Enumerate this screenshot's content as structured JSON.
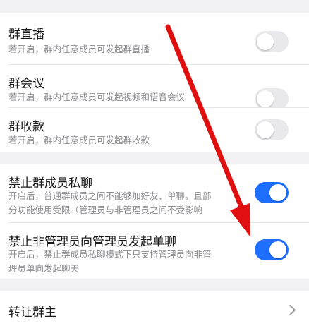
{
  "settings": {
    "group_live": {
      "title": "群直播",
      "desc": "若开启，群内任意成员可发起群直播",
      "enabled": false
    },
    "group_meeting": {
      "title": "群会议",
      "desc": "若开启，群内任意成员可发起视频和语音会议",
      "enabled": false
    },
    "group_payment": {
      "title": "群收款",
      "desc": "若开启，群内任意成员可发起群收款",
      "enabled": false
    },
    "ban_private_chat": {
      "title": "禁止群成员私聊",
      "desc_line1": "开启后，普通群成员之间不能够加好友、单聊，且部",
      "desc_line2": "分功能使用受限（管理员与非管理员之间不受影响",
      "enabled": true
    },
    "ban_nonadmin_to_admin": {
      "title": "禁止非管理员向管理员发起单聊",
      "desc_line1": "开启后，禁止群成员私聊模式下只支持管理员向非管",
      "desc_line2": "理员单向发起聊天",
      "enabled": true
    }
  },
  "transfer": {
    "title": "转让群主"
  },
  "colors": {
    "toggle_on": "#1f6fff",
    "toggle_off": "#e9e9ec",
    "annotation_arrow": "#e01010"
  },
  "icons": {
    "chevron": "chevron-right-icon",
    "annotation": "red-arrow-annotation"
  }
}
